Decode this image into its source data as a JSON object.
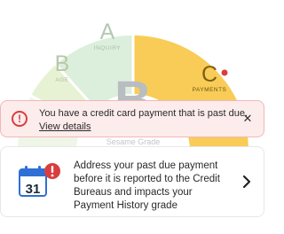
{
  "gauge": {
    "segments": [
      {
        "grade": "A",
        "label": "INQUIRY"
      },
      {
        "grade": "B",
        "label": "AGE"
      },
      {
        "grade": "C",
        "label": "PAYMENTS"
      }
    ],
    "center_grade": "B",
    "center_caption": "Sesame Grade",
    "colors": {
      "inquiry": "#dcefdc",
      "age": "#e6f2d3",
      "lower_left": "#eff6e7",
      "payments": "#f8cc57",
      "alert_dot": "#d93e3e"
    }
  },
  "alert": {
    "message": "You have a credit card payment that is past due.",
    "link": "View details",
    "icon": "alert-circle-icon",
    "close_icon": "close-icon"
  },
  "card": {
    "calendar_day": "31",
    "text": "Address your past due payment before it is reported to the Credit Bureaus and impacts your Payment History grade",
    "icon": "calendar-alert-icon",
    "chevron": "chevron-right-icon"
  }
}
